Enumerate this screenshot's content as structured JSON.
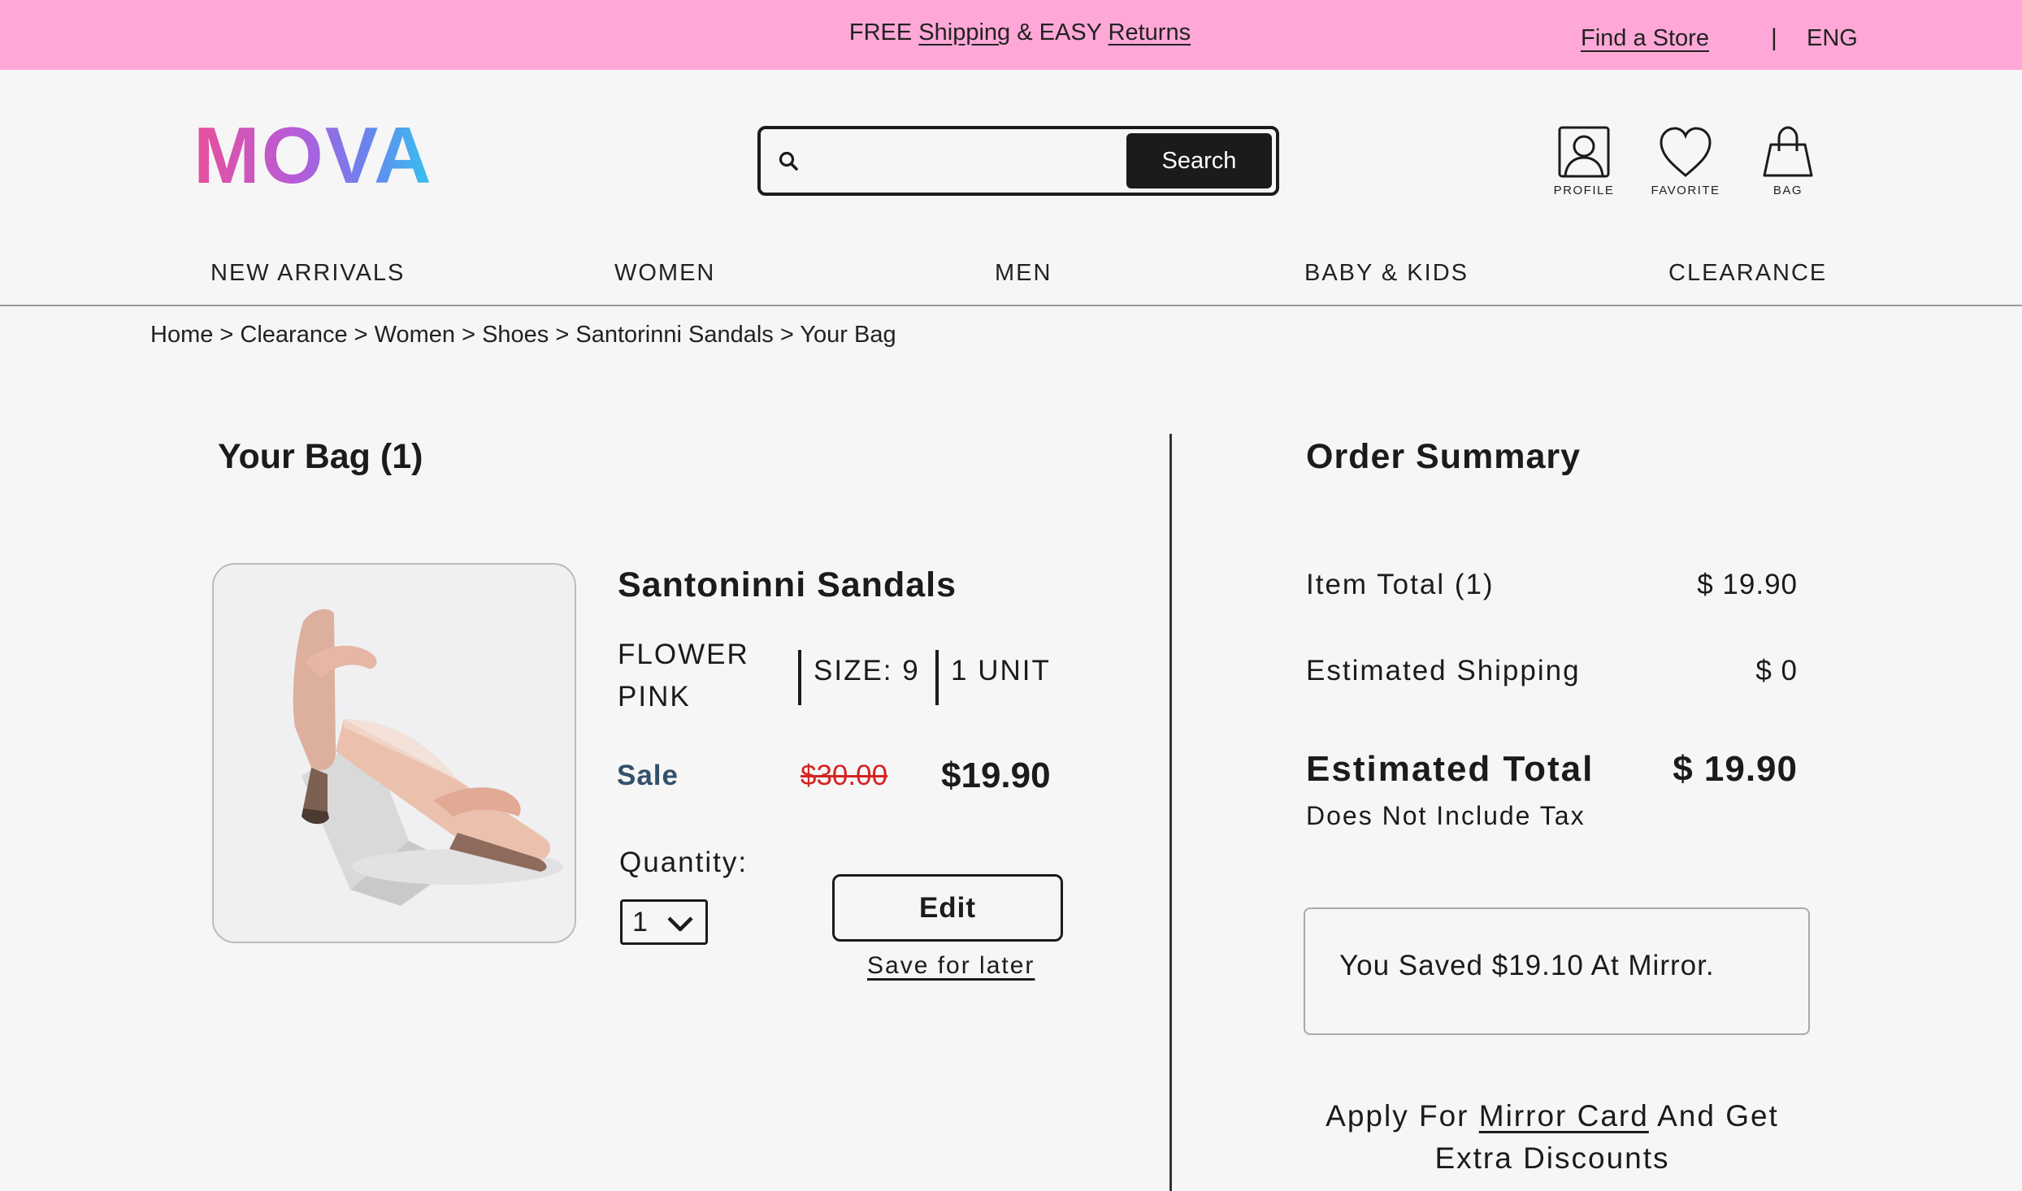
{
  "promo": {
    "free": "FREE",
    "shipping": "Shipping",
    "and_easy": "& EASY",
    "returns": "Returns",
    "find_store": "Find a Store",
    "separator": "|",
    "language": "ENG"
  },
  "header": {
    "logo": "MOVA",
    "search_button": "Search",
    "search_value": "",
    "icons": {
      "profile": "PROFILE",
      "favorite": "FAVORITE",
      "bag": "BAG"
    }
  },
  "nav": [
    "NEW ARRIVALS",
    "WOMEN",
    "MEN",
    "BABY & KIDS",
    "CLEARANCE"
  ],
  "breadcrumb": "Home > Clearance > Women > Shoes > Santorinni Sandals > Your Bag",
  "bag": {
    "title": "Your Bag (1)",
    "item": {
      "name": "Santoninni Sandals",
      "color": "FLOWER PINK",
      "size": "SIZE: 9",
      "units": "1 UNIT",
      "sale_label": "Sale",
      "original_price": "$30.00",
      "sale_price": "$19.90",
      "quantity_label": "Quantity:",
      "quantity": "1",
      "edit": "Edit",
      "save_for_later": "Save for later"
    }
  },
  "summary": {
    "title": "Order Summary",
    "item_total_label": "Item Total (1)",
    "item_total": "$ 19.90",
    "shipping_label": "Estimated Shipping",
    "shipping": "$ 0",
    "total_label": "Estimated Total",
    "total": "$ 19.90",
    "tax_note": "Does Not Include Tax",
    "saved": "You Saved $19.10 At Mirror.",
    "apply_prefix": "Apply For",
    "apply_link": "Mirror Card",
    "apply_suffix": "And Get Extra Discounts"
  },
  "colors": {
    "promo_bg": "#ffa8d7",
    "sale_label": "#34506a",
    "strike_price": "#d42424",
    "dark": "#1b1b1b"
  }
}
